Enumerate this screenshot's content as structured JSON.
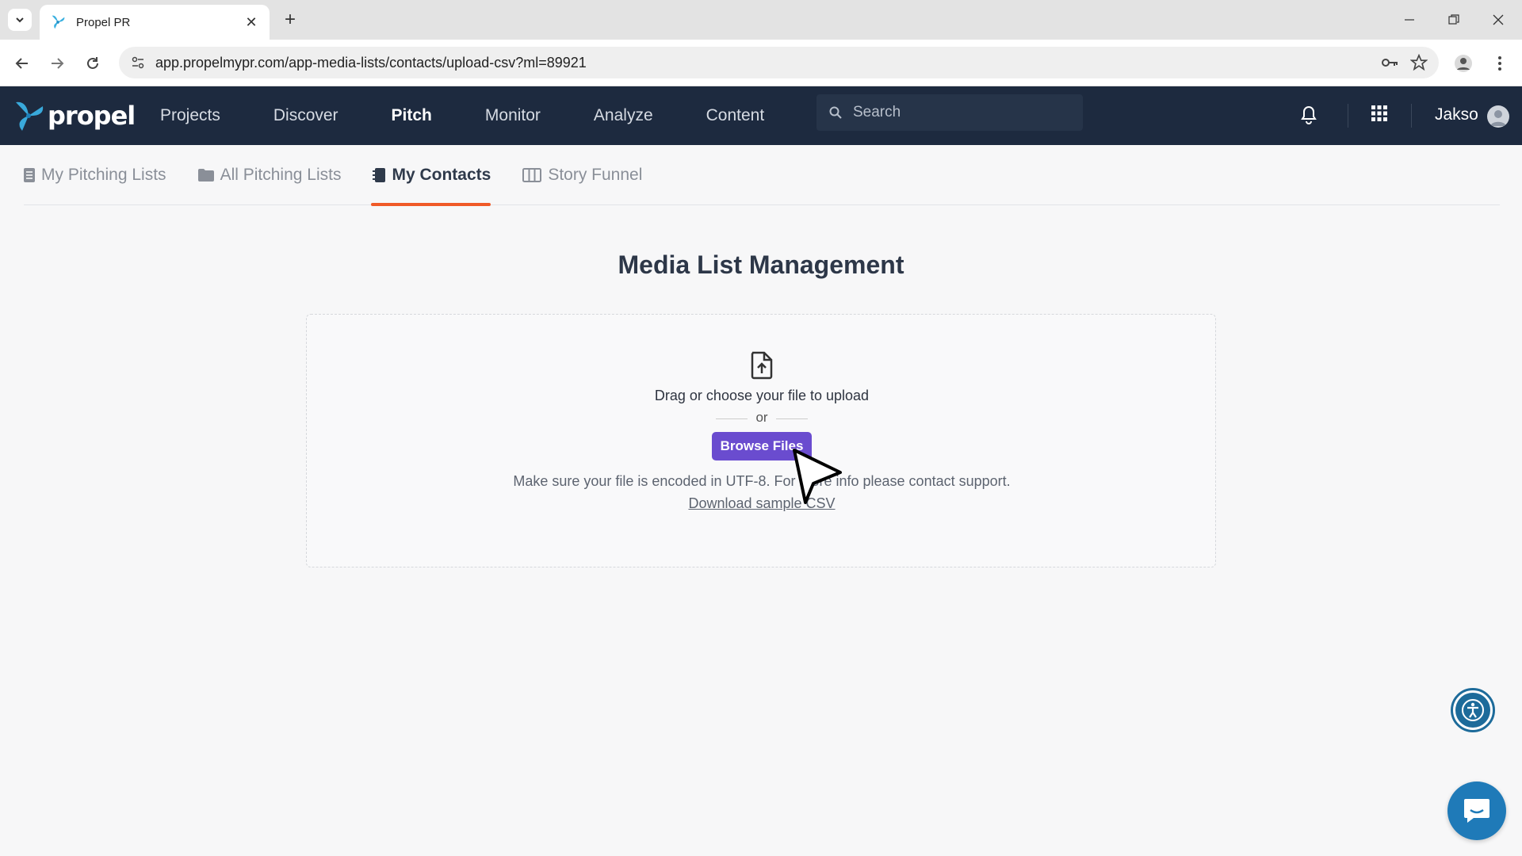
{
  "browser": {
    "tab_title": "Propel PR",
    "url": "app.propelmypr.com/app-media-lists/contacts/upload-csv?ml=89921"
  },
  "header": {
    "logo_text": "propel",
    "nav": [
      "Projects",
      "Discover",
      "Pitch",
      "Monitor",
      "Analyze",
      "Content"
    ],
    "active_nav": "Pitch",
    "search_placeholder": "Search",
    "user_name": "Jakso"
  },
  "subnav": {
    "tabs": [
      "My Pitching Lists",
      "All Pitching Lists",
      "My Contacts",
      "Story Funnel"
    ],
    "active": "My Contacts"
  },
  "page": {
    "title": "Media List Management",
    "dropzone": {
      "instruction": "Drag or choose your file to upload",
      "or": "or",
      "browse_label": "Browse Files",
      "note": "Make sure your file is encoded in UTF-8. For more info please contact support.",
      "sample_link": "Download sample CSV"
    }
  },
  "colors": {
    "header_bg": "#1d2a3f",
    "accent_orange": "#f05a28",
    "button_purple": "#6a4ccf",
    "chat_blue": "#1f7ab8"
  }
}
